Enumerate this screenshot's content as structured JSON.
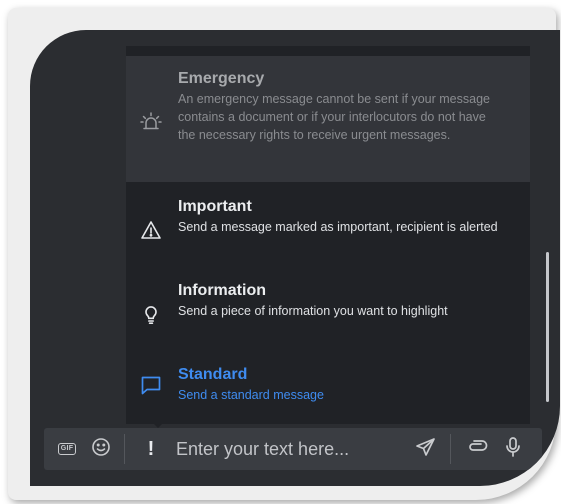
{
  "priority_menu": {
    "items": [
      {
        "title": "Emergency",
        "description": "An emergency message cannot be sent if your message contains a document or if your interlocutors do not have the necessary rights to receive urgent messages.",
        "icon": "siren-icon",
        "state": "disabled"
      },
      {
        "title": "Important",
        "description": "Send a message marked as important, recipient is alerted",
        "icon": "warning-triangle-icon",
        "state": "enabled"
      },
      {
        "title": "Information",
        "description": "Send a piece of information you want to highlight",
        "icon": "lightbulb-icon",
        "state": "enabled"
      },
      {
        "title": "Standard",
        "description": "Send a standard message",
        "icon": "message-bubble-icon",
        "state": "selected"
      }
    ]
  },
  "composer": {
    "gif_label": "GIF",
    "priority_symbol": "!",
    "placeholder": "Enter your text here..."
  },
  "colors": {
    "accent": "#3f8cf0",
    "background": "#2b2d31",
    "menu_background": "#202226"
  }
}
